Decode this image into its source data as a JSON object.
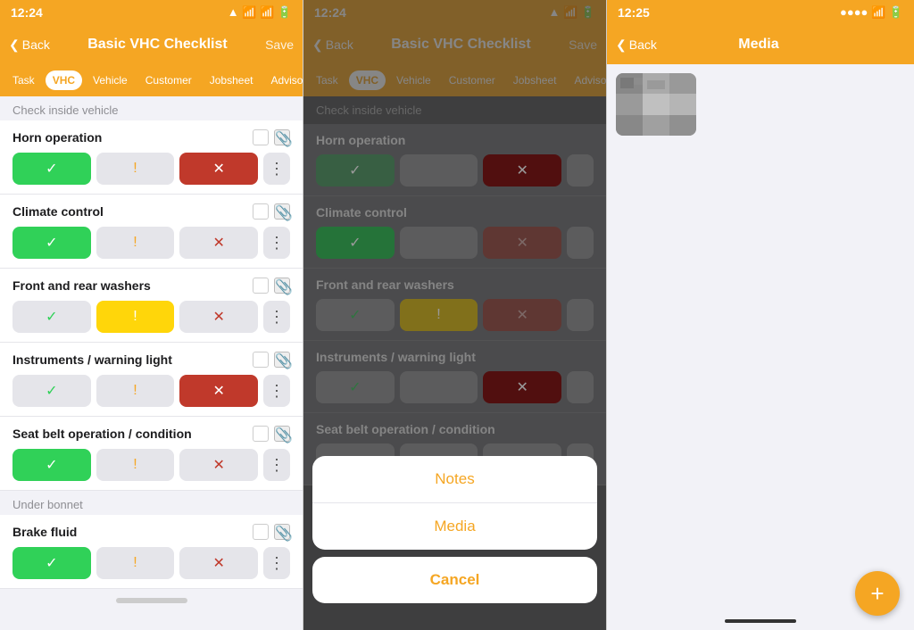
{
  "panels": {
    "left": {
      "status": {
        "time": "12:24",
        "arrow": "▲",
        "signal": "●●●●",
        "wifi": "wifi",
        "battery": "battery"
      },
      "nav": {
        "back": "Back",
        "title": "Basic VHC Checklist",
        "save": "Save"
      },
      "tabs": [
        {
          "label": "Task",
          "active": false
        },
        {
          "label": "VHC",
          "active": true
        },
        {
          "label": "Vehicle",
          "active": false
        },
        {
          "label": "Customer",
          "active": false
        },
        {
          "label": "Jobsheet",
          "active": false
        },
        {
          "label": "Advisories",
          "active": false
        }
      ],
      "section1": "Check inside vehicle",
      "items": [
        {
          "title": "Horn operation",
          "status": "green",
          "buttons": [
            "green",
            "neutral",
            "red",
            "more"
          ]
        },
        {
          "title": "Climate control",
          "status": "green",
          "buttons": [
            "green",
            "neutral",
            "red",
            "more"
          ]
        },
        {
          "title": "Front and rear washers",
          "status": "yellow",
          "buttons": [
            "green",
            "yellow",
            "red",
            "more"
          ]
        },
        {
          "title": "Instruments / warning light",
          "status": "red",
          "buttons": [
            "green",
            "neutral",
            "red",
            "more"
          ]
        },
        {
          "title": "Seat belt operation / condition",
          "status": "green",
          "buttons": [
            "green",
            "neutral",
            "red",
            "more"
          ]
        }
      ],
      "section2": "Under bonnet",
      "items2": [
        {
          "title": "Brake fluid",
          "status": "green",
          "buttons": [
            "green",
            "neutral",
            "red",
            "more"
          ]
        }
      ]
    },
    "middle": {
      "status": {
        "time": "12:24",
        "arrow": "▲",
        "signal": "wifi",
        "battery": "battery"
      },
      "nav": {
        "back": "Back",
        "title": "Basic VHC Checklist",
        "save": "Save"
      },
      "tabs": [
        {
          "label": "Task",
          "active": false
        },
        {
          "label": "VHC",
          "active": true
        },
        {
          "label": "Vehicle",
          "active": false
        },
        {
          "label": "Customer",
          "active": false
        },
        {
          "label": "Jobsheet",
          "active": false
        },
        {
          "label": "Advisories",
          "active": false
        }
      ],
      "actionSheet": {
        "notes": "Notes",
        "media": "Media",
        "cancel": "Cancel"
      }
    },
    "right": {
      "status": {
        "time": "12:25",
        "signal": "●●●●",
        "wifi": "wifi",
        "battery": "battery"
      },
      "nav": {
        "back": "Back",
        "title": "Media"
      },
      "fab": "+"
    }
  }
}
